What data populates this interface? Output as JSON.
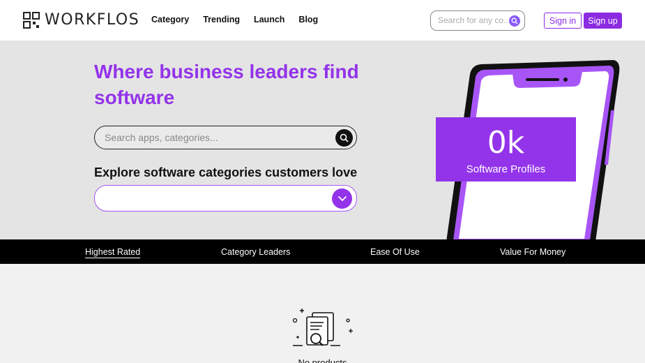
{
  "header": {
    "logo_text": "WORKFLOS",
    "nav": [
      "Category",
      "Trending",
      "Launch",
      "Blog"
    ],
    "search_placeholder": "Search for any co...",
    "signin_label": "Sign in",
    "signup_label": "Sign up"
  },
  "hero": {
    "headline": "Where business leaders find software",
    "search_placeholder": "Search apps, categories...",
    "explore_title": "Explore software categories customers love",
    "category_value": "",
    "stat_value": "0k",
    "stat_label": "Software Profiles"
  },
  "tabs": [
    "Highest Rated",
    "Category Leaders",
    "Ease Of Use",
    "Value For Money"
  ],
  "empty": {
    "message": "No products"
  },
  "colors": {
    "accent": "#9333ea",
    "accent_dark": "#8b2be2",
    "tab_bar": "#000000",
    "hero_bg": "#e4e4e4"
  },
  "icons": [
    "logo-mark-icon",
    "search-icon",
    "chevron-down-icon",
    "document-search-icon"
  ]
}
